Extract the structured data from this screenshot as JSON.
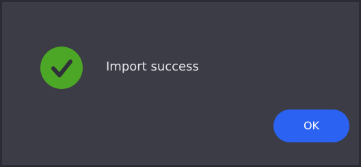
{
  "dialog": {
    "message": "Import success",
    "ok_label": "OK",
    "icon": "check-circle-icon"
  },
  "colors": {
    "background": "#3b3c46",
    "success_green": "#4ca726",
    "check_mark": "#2f3138",
    "button_blue": "#2c62f2"
  }
}
